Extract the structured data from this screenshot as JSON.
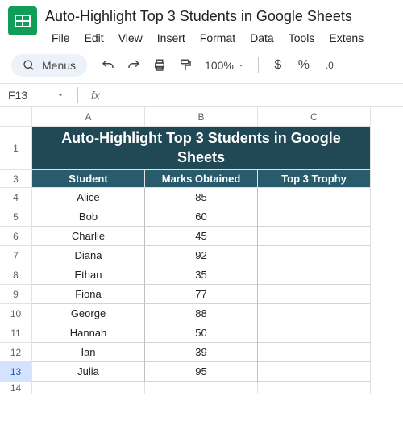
{
  "doc_title": "Auto-Highlight Top 3 Students in Google Sheets",
  "menu": [
    "File",
    "Edit",
    "View",
    "Insert",
    "Format",
    "Data",
    "Tools",
    "Extens"
  ],
  "menus_label": "Menus",
  "zoom": "100%",
  "name_box": "F13",
  "fx": "fx",
  "columns": [
    "A",
    "B",
    "C"
  ],
  "title_row_num": "1",
  "title_text": "Auto-Highlight Top 3 Students in Google Sheets",
  "header_row_num": "3",
  "headers": [
    "Student",
    "Marks Obtained",
    "Top 3 Trophy"
  ],
  "rows": [
    {
      "n": "4",
      "student": "Alice",
      "marks": "85",
      "trophy": ""
    },
    {
      "n": "5",
      "student": "Bob",
      "marks": "60",
      "trophy": ""
    },
    {
      "n": "6",
      "student": "Charlie",
      "marks": "45",
      "trophy": ""
    },
    {
      "n": "7",
      "student": "Diana",
      "marks": "92",
      "trophy": ""
    },
    {
      "n": "8",
      "student": "Ethan",
      "marks": "35",
      "trophy": ""
    },
    {
      "n": "9",
      "student": "Fiona",
      "marks": "77",
      "trophy": ""
    },
    {
      "n": "10",
      "student": "George",
      "marks": "88",
      "trophy": ""
    },
    {
      "n": "11",
      "student": "Hannah",
      "marks": "50",
      "trophy": ""
    },
    {
      "n": "12",
      "student": "Ian",
      "marks": "39",
      "trophy": ""
    },
    {
      "n": "13",
      "student": "Julia",
      "marks": "95",
      "trophy": ""
    }
  ],
  "empty_row_num": "14",
  "selected_row": "13",
  "toolbar_symbols": {
    "dollar": "$",
    "percent": "%",
    "decimal": ".0"
  }
}
